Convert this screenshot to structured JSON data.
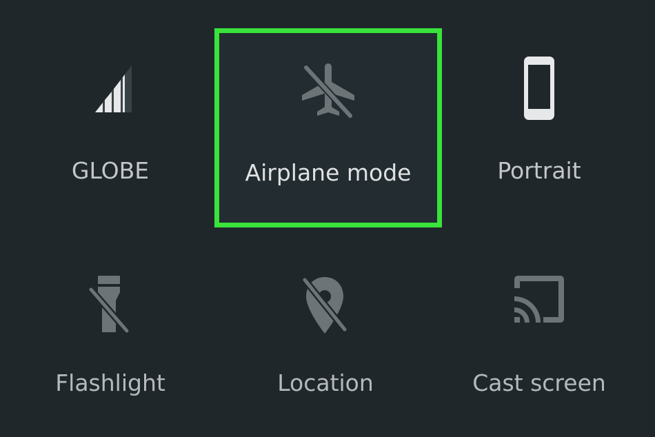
{
  "quick_settings": {
    "tiles": [
      {
        "label": "GLOBE",
        "icon": "signal-icon",
        "state": "on"
      },
      {
        "label": "Airplane mode",
        "icon": "airplane-off-icon",
        "state": "off",
        "highlighted": true
      },
      {
        "label": "Portrait",
        "icon": "phone-portrait-icon",
        "state": "on"
      },
      {
        "label": "Flashlight",
        "icon": "flashlight-off-icon",
        "state": "off"
      },
      {
        "label": "Location",
        "icon": "location-off-icon",
        "state": "off"
      },
      {
        "label": "Cast screen",
        "icon": "cast-icon",
        "state": "off"
      }
    ]
  },
  "colors": {
    "background": "#20272b",
    "highlight_border": "#39e33b",
    "label_text": "#c3c7c9",
    "icon_active": "#e6e8e9",
    "icon_inactive": "#6c7478"
  }
}
